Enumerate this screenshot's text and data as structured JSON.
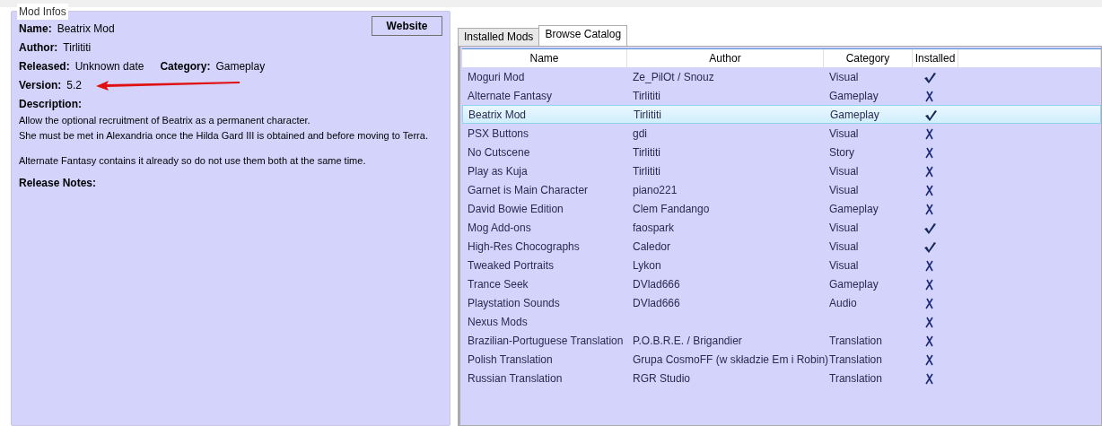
{
  "mod_infos": {
    "title": "Mod Infos",
    "fields": [
      {
        "label": "Name:",
        "value": "Beatrix Mod"
      },
      {
        "label": "Author:",
        "value": "Tirlititi"
      },
      {
        "label": "Released:",
        "value": "Unknown date"
      },
      {
        "label": "Category:",
        "value": "Gameplay"
      },
      {
        "label": "Version:",
        "value": "5.2"
      }
    ],
    "website_button": "Website",
    "annotation_arrow": true,
    "description_label": "Description:",
    "description": [
      [
        "Allow the optional recruitment of Beatrix as a permanent character.",
        "She must be met in Alexandria once the Hilda Gard III is obtained and before moving to Terra."
      ],
      [
        "Alternate Fantasy contains it already so do not use them both at the same time."
      ]
    ],
    "release_notes_label": "Release Notes:"
  },
  "tabs": [
    {
      "label": "Installed Mods",
      "selected": false
    },
    {
      "label": "Browse Catalog",
      "selected": true
    }
  ],
  "table": {
    "columns": [
      "Name",
      "Author",
      "Category",
      "Installed"
    ],
    "rows": [
      {
        "name": "Moguri Mod",
        "author": "Ze_PilOt / Snouz",
        "category": "Visual",
        "installed": true,
        "selected": false
      },
      {
        "name": "Alternate Fantasy",
        "author": "Tirlititi",
        "category": "Gameplay",
        "installed": false,
        "selected": false
      },
      {
        "name": "Beatrix Mod",
        "author": "Tirlititi",
        "category": "Gameplay",
        "installed": true,
        "selected": true
      },
      {
        "name": "PSX Buttons",
        "author": "gdi",
        "category": "Visual",
        "installed": false,
        "selected": false
      },
      {
        "name": "No Cutscene",
        "author": "Tirlititi",
        "category": "Story",
        "installed": false,
        "selected": false
      },
      {
        "name": "Play as Kuja",
        "author": "Tirlititi",
        "category": "Visual",
        "installed": false,
        "selected": false
      },
      {
        "name": "Garnet is Main Character",
        "author": "piano221",
        "category": "Visual",
        "installed": false,
        "selected": false
      },
      {
        "name": "David Bowie Edition",
        "author": "Clem Fandango",
        "category": "Gameplay",
        "installed": false,
        "selected": false
      },
      {
        "name": "Mog Add-ons",
        "author": "faospark",
        "category": "Visual",
        "installed": true,
        "selected": false
      },
      {
        "name": "High-Res Chocographs",
        "author": "Caledor",
        "category": "Visual",
        "installed": true,
        "selected": false
      },
      {
        "name": "Tweaked Portraits",
        "author": "Lykon",
        "category": "Visual",
        "installed": false,
        "selected": false
      },
      {
        "name": "Trance Seek",
        "author": "DVlad666",
        "category": "Gameplay",
        "installed": false,
        "selected": false
      },
      {
        "name": "Playstation Sounds",
        "author": "DVlad666",
        "category": "Audio",
        "installed": false,
        "selected": false
      },
      {
        "name": "Nexus Mods",
        "installed": false,
        "selected": false
      },
      {
        "name": "Brazilian-Portuguese Translation",
        "author": "P.O.B.R.E. / Brigandier",
        "category": "Translation",
        "installed": false,
        "selected": false
      },
      {
        "name": "Polish Translation",
        "author": "Grupa CosmoFF (w składzie Em i Robin)",
        "category": "Translation",
        "installed": false,
        "selected": false
      },
      {
        "name": "Russian Translation",
        "author": "RGR Studio",
        "category": "Translation",
        "installed": false,
        "selected": false
      }
    ]
  }
}
